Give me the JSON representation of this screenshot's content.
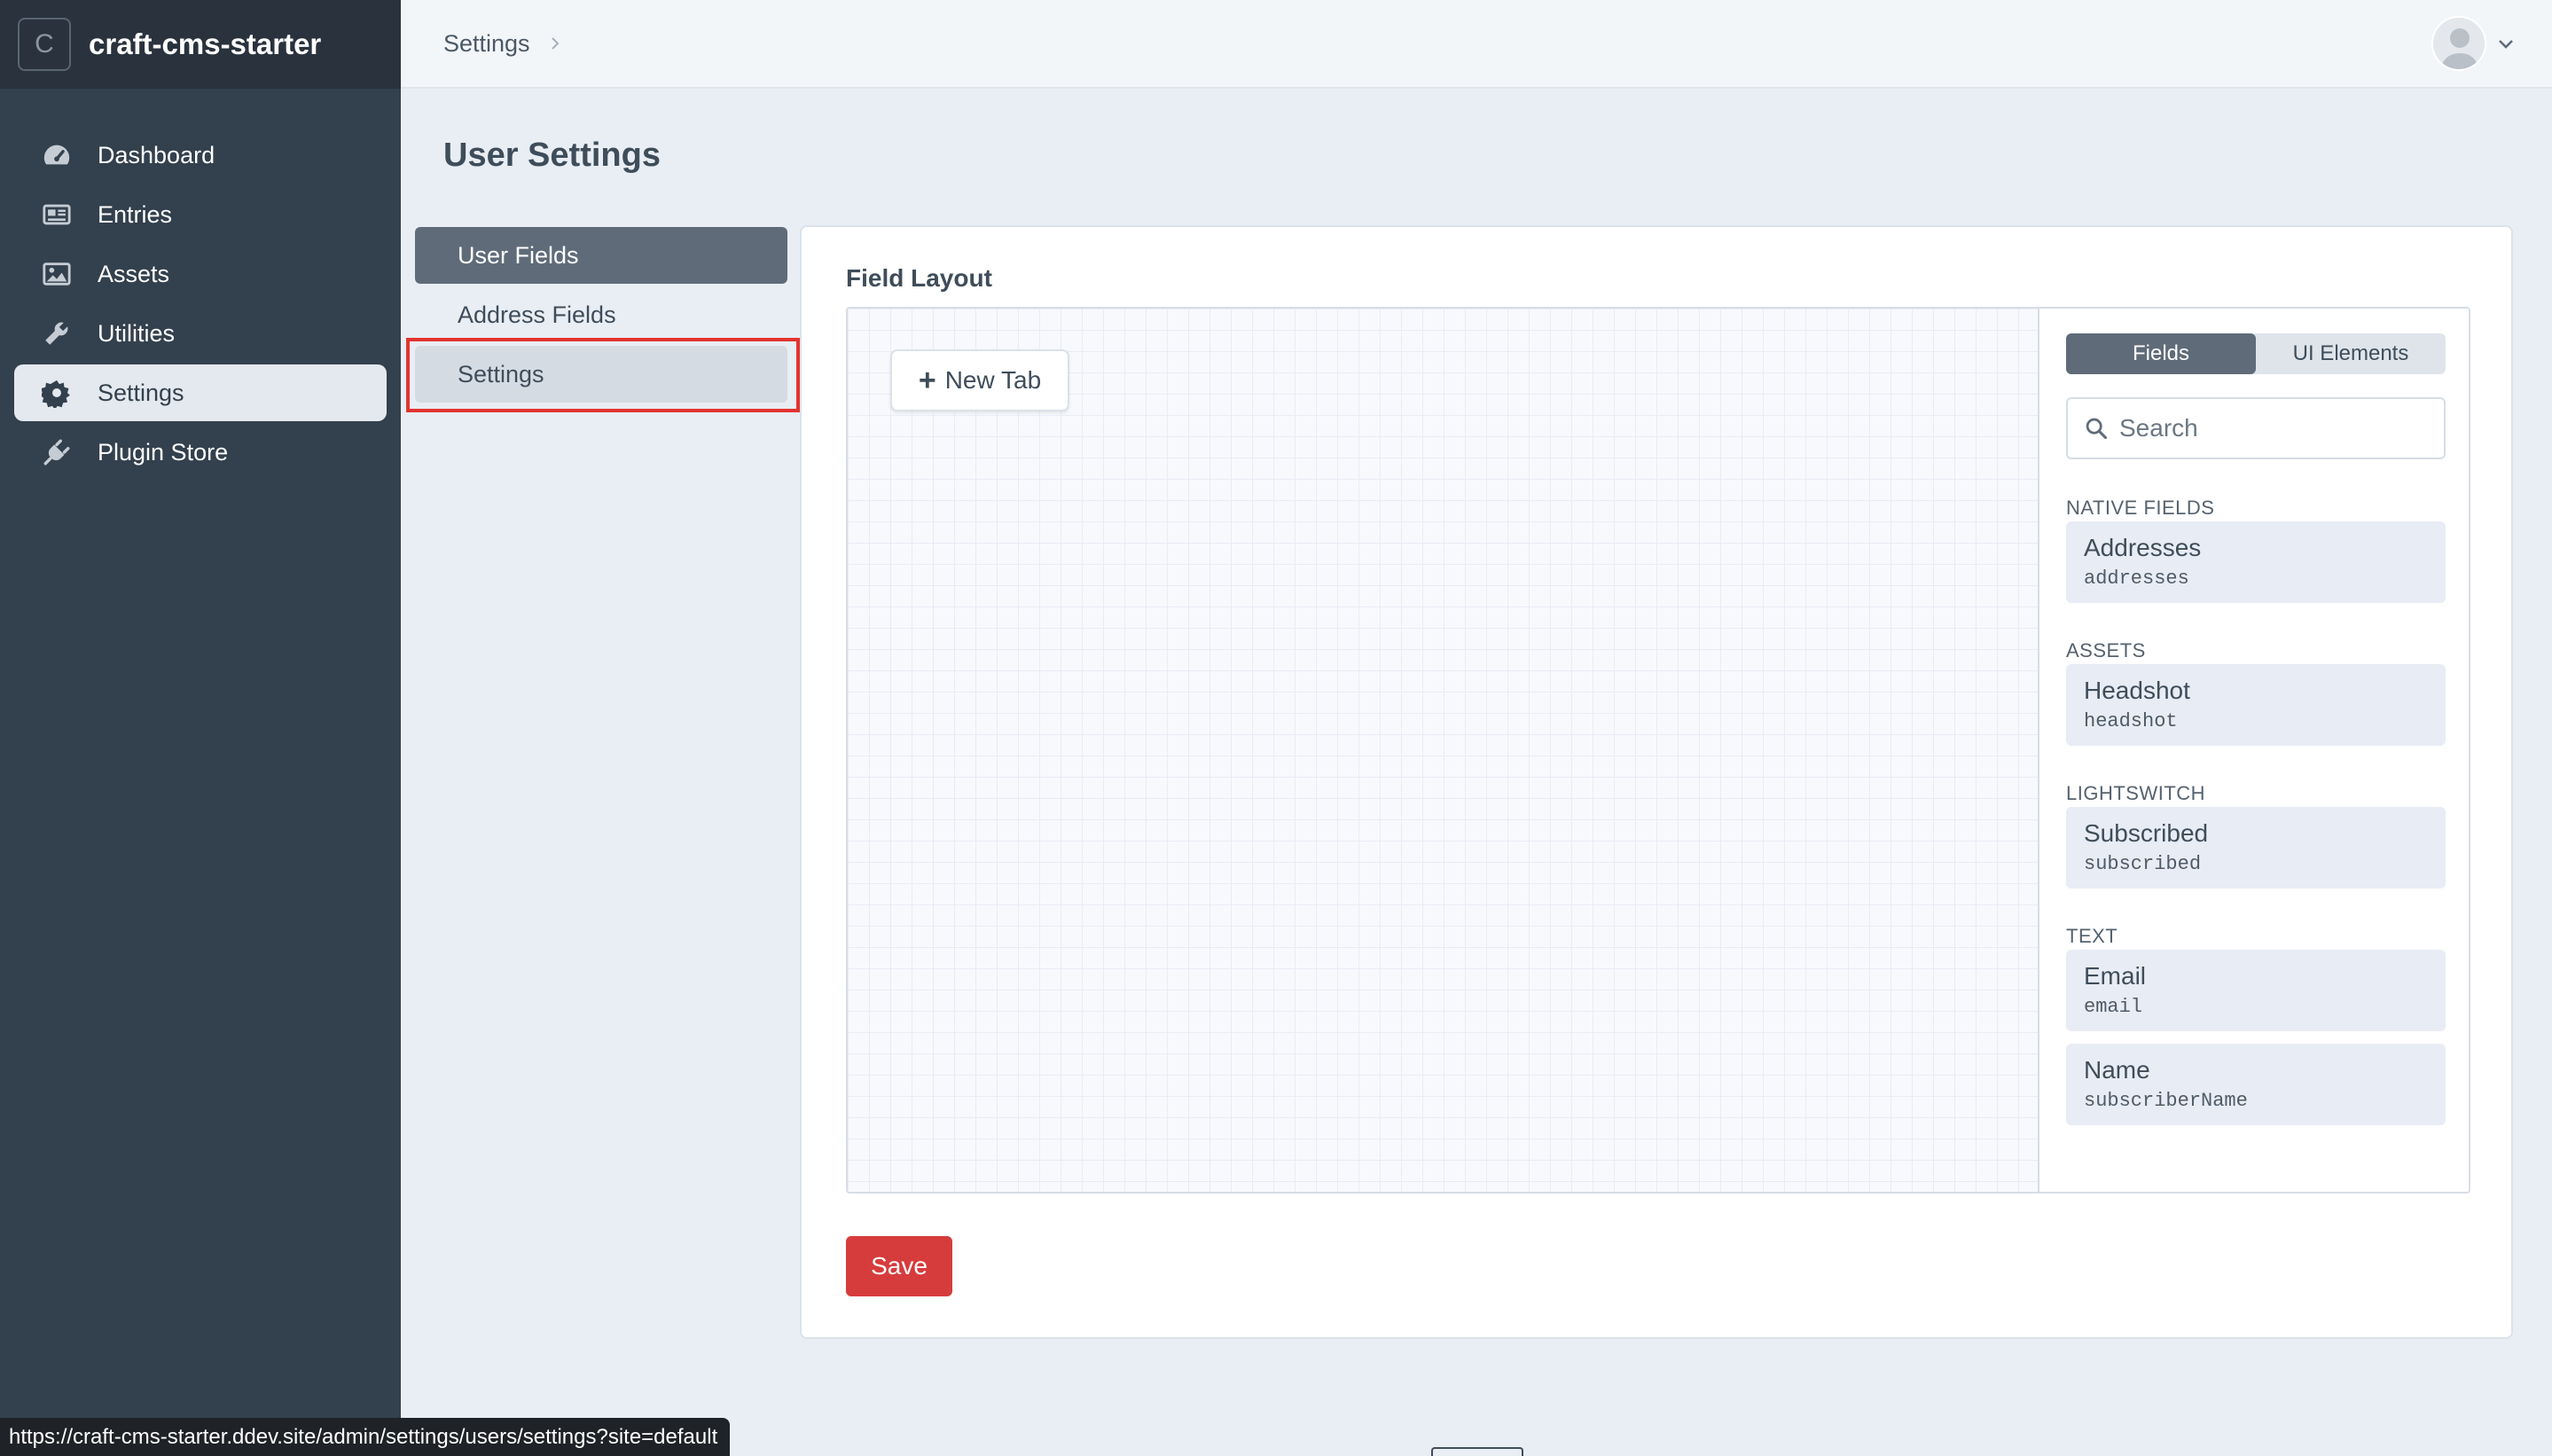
{
  "site": {
    "logo_letter": "C",
    "name": "craft-cms-starter"
  },
  "nav": {
    "items": [
      {
        "label": "Dashboard",
        "icon": "gauge-icon"
      },
      {
        "label": "Entries",
        "icon": "newspaper-icon"
      },
      {
        "label": "Assets",
        "icon": "image-icon"
      },
      {
        "label": "Utilities",
        "icon": "wrench-icon"
      },
      {
        "label": "Settings",
        "icon": "gear-icon",
        "active": true
      },
      {
        "label": "Plugin Store",
        "icon": "plug-icon"
      }
    ]
  },
  "header": {
    "breadcrumb": "Settings"
  },
  "page": {
    "title": "User Settings"
  },
  "subnav": {
    "items": [
      {
        "label": "User Fields",
        "selected": true
      },
      {
        "label": "Address Fields"
      },
      {
        "label": "Settings",
        "highlighted": true
      }
    ]
  },
  "field_layout": {
    "label": "Field Layout",
    "new_tab_label": "New Tab",
    "library": {
      "tabs": [
        "Fields",
        "UI Elements"
      ],
      "active_tab": "Fields",
      "search_placeholder": "Search",
      "groups": [
        {
          "label": "NATIVE FIELDS",
          "fields": [
            {
              "name": "Addresses",
              "handle": "addresses"
            }
          ]
        },
        {
          "label": "ASSETS",
          "fields": [
            {
              "name": "Headshot",
              "handle": "headshot"
            }
          ]
        },
        {
          "label": "LIGHTSWITCH",
          "fields": [
            {
              "name": "Subscribed",
              "handle": "subscribed"
            }
          ]
        },
        {
          "label": "TEXT",
          "fields": [
            {
              "name": "Email",
              "handle": "email"
            },
            {
              "name": "Name",
              "handle": "subscriberName"
            }
          ]
        }
      ]
    }
  },
  "actions": {
    "save_label": "Save"
  },
  "status_bar": {
    "url": "https://craft-cms-starter.ddev.site/admin/settings/users/settings?site=default"
  },
  "colors": {
    "sidebar": "#33404d",
    "primary_button": "#d73c3c",
    "highlight": "#e3342f"
  }
}
